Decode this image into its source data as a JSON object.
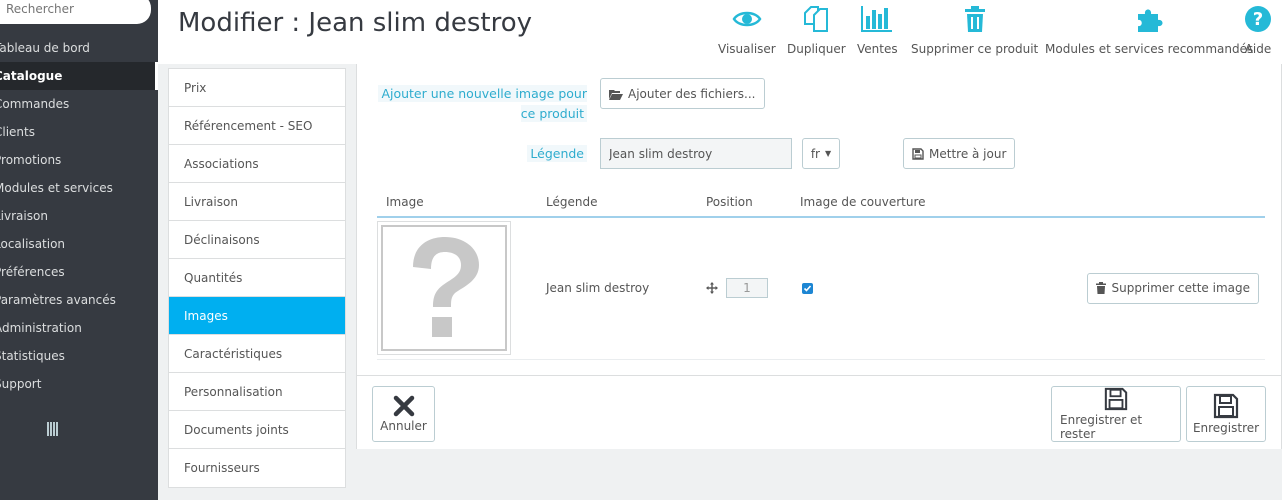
{
  "nav": {
    "search_placeholder": "Rechercher",
    "items": [
      {
        "label": "Tableau de bord",
        "active": false
      },
      {
        "label": "Catalogue",
        "active": true
      },
      {
        "label": "Commandes",
        "active": false
      },
      {
        "label": "Clients",
        "active": false
      },
      {
        "label": "Promotions",
        "active": false
      },
      {
        "label": "Modules et services",
        "active": false
      },
      {
        "label": "Livraison",
        "active": false
      },
      {
        "label": "Localisation",
        "active": false
      },
      {
        "label": "Préférences",
        "active": false
      },
      {
        "label": "Paramètres avancés",
        "active": false
      },
      {
        "label": "Administration",
        "active": false
      },
      {
        "label": "Statistiques",
        "active": false
      },
      {
        "label": "Support",
        "active": false
      }
    ]
  },
  "header": {
    "title": "Modifier : Jean slim destroy",
    "toolbar": {
      "view": "Visualiser",
      "duplicate": "Dupliquer",
      "sales": "Ventes",
      "delete": "Supprimer ce produit",
      "modules": "Modules et services recommandés",
      "help": "Aide"
    }
  },
  "tabs": [
    {
      "label": "Prix",
      "active": false
    },
    {
      "label": "Référencement - SEO",
      "active": false
    },
    {
      "label": "Associations",
      "active": false
    },
    {
      "label": "Livraison",
      "active": false
    },
    {
      "label": "Déclinaisons",
      "active": false
    },
    {
      "label": "Quantités",
      "active": false
    },
    {
      "label": "Images",
      "active": true
    },
    {
      "label": "Caractéristiques",
      "active": false
    },
    {
      "label": "Personnalisation",
      "active": false
    },
    {
      "label": "Documents joints",
      "active": false
    },
    {
      "label": "Fournisseurs",
      "active": false
    }
  ],
  "images": {
    "add_label": "Ajouter une nouvelle image pour ce produit",
    "add_files_button": "Ajouter des fichiers...",
    "legend_label": "Légende",
    "legend_value": "Jean slim destroy",
    "language": "fr",
    "update_button": "Mettre à jour",
    "columns": [
      "Image",
      "Légende",
      "Position",
      "Image de couverture"
    ],
    "rows": [
      {
        "legend": "Jean slim destroy",
        "position": "1",
        "cover": true,
        "delete_label": "Supprimer cette image"
      }
    ]
  },
  "footer": {
    "cancel": "Annuler",
    "save_stay": "Enregistrer et rester",
    "save": "Enregistrer"
  },
  "colors": {
    "accent": "#00aff0",
    "nav_bg": "#363a41",
    "icon": "#25b9d7"
  }
}
